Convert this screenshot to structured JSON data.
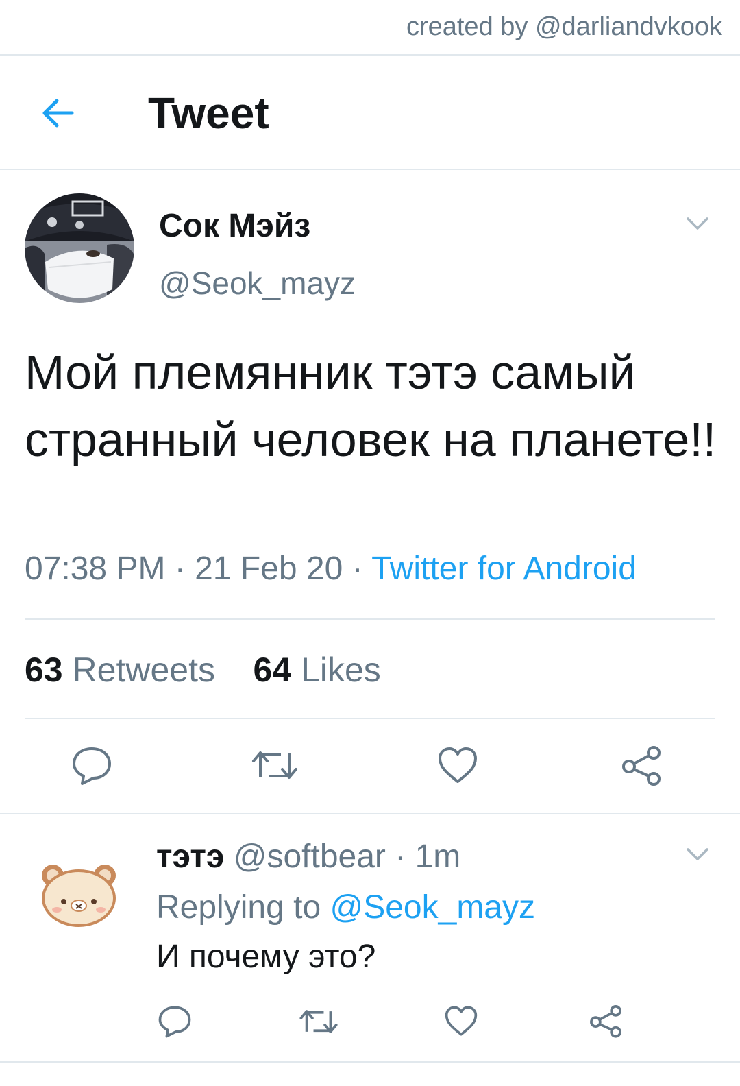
{
  "credit": "created by @darliandvkook",
  "header": {
    "title": "Tweet"
  },
  "tweet": {
    "author_name": "Сок Мэйз",
    "author_handle": "@Seok_mayz",
    "text": "Мой племянник тэтэ самый странный человек на планете!!",
    "time": "07:38 PM",
    "date": "21 Feb 20",
    "separator": " · ",
    "source": "Twitter for Android",
    "retweets_count": "63",
    "retweets_label": "Retweets",
    "likes_count": "64",
    "likes_label": "Likes"
  },
  "reply": {
    "name": "тэтэ",
    "handle": "@softbear",
    "time": "1m",
    "replying_prefix": "Replying to",
    "replying_to": "@Seok_mayz",
    "text": "И почему это?"
  },
  "icons": {
    "back": "arrow-left-icon",
    "more": "chevron-down-icon",
    "reply": "speech-bubble-icon",
    "retweet": "retweet-icon",
    "like": "heart-icon",
    "share": "share-icon"
  },
  "colors": {
    "accent": "#1da1f2",
    "secondary_text": "#657786",
    "primary_text": "#14171a",
    "divider": "#e1e8ed"
  }
}
